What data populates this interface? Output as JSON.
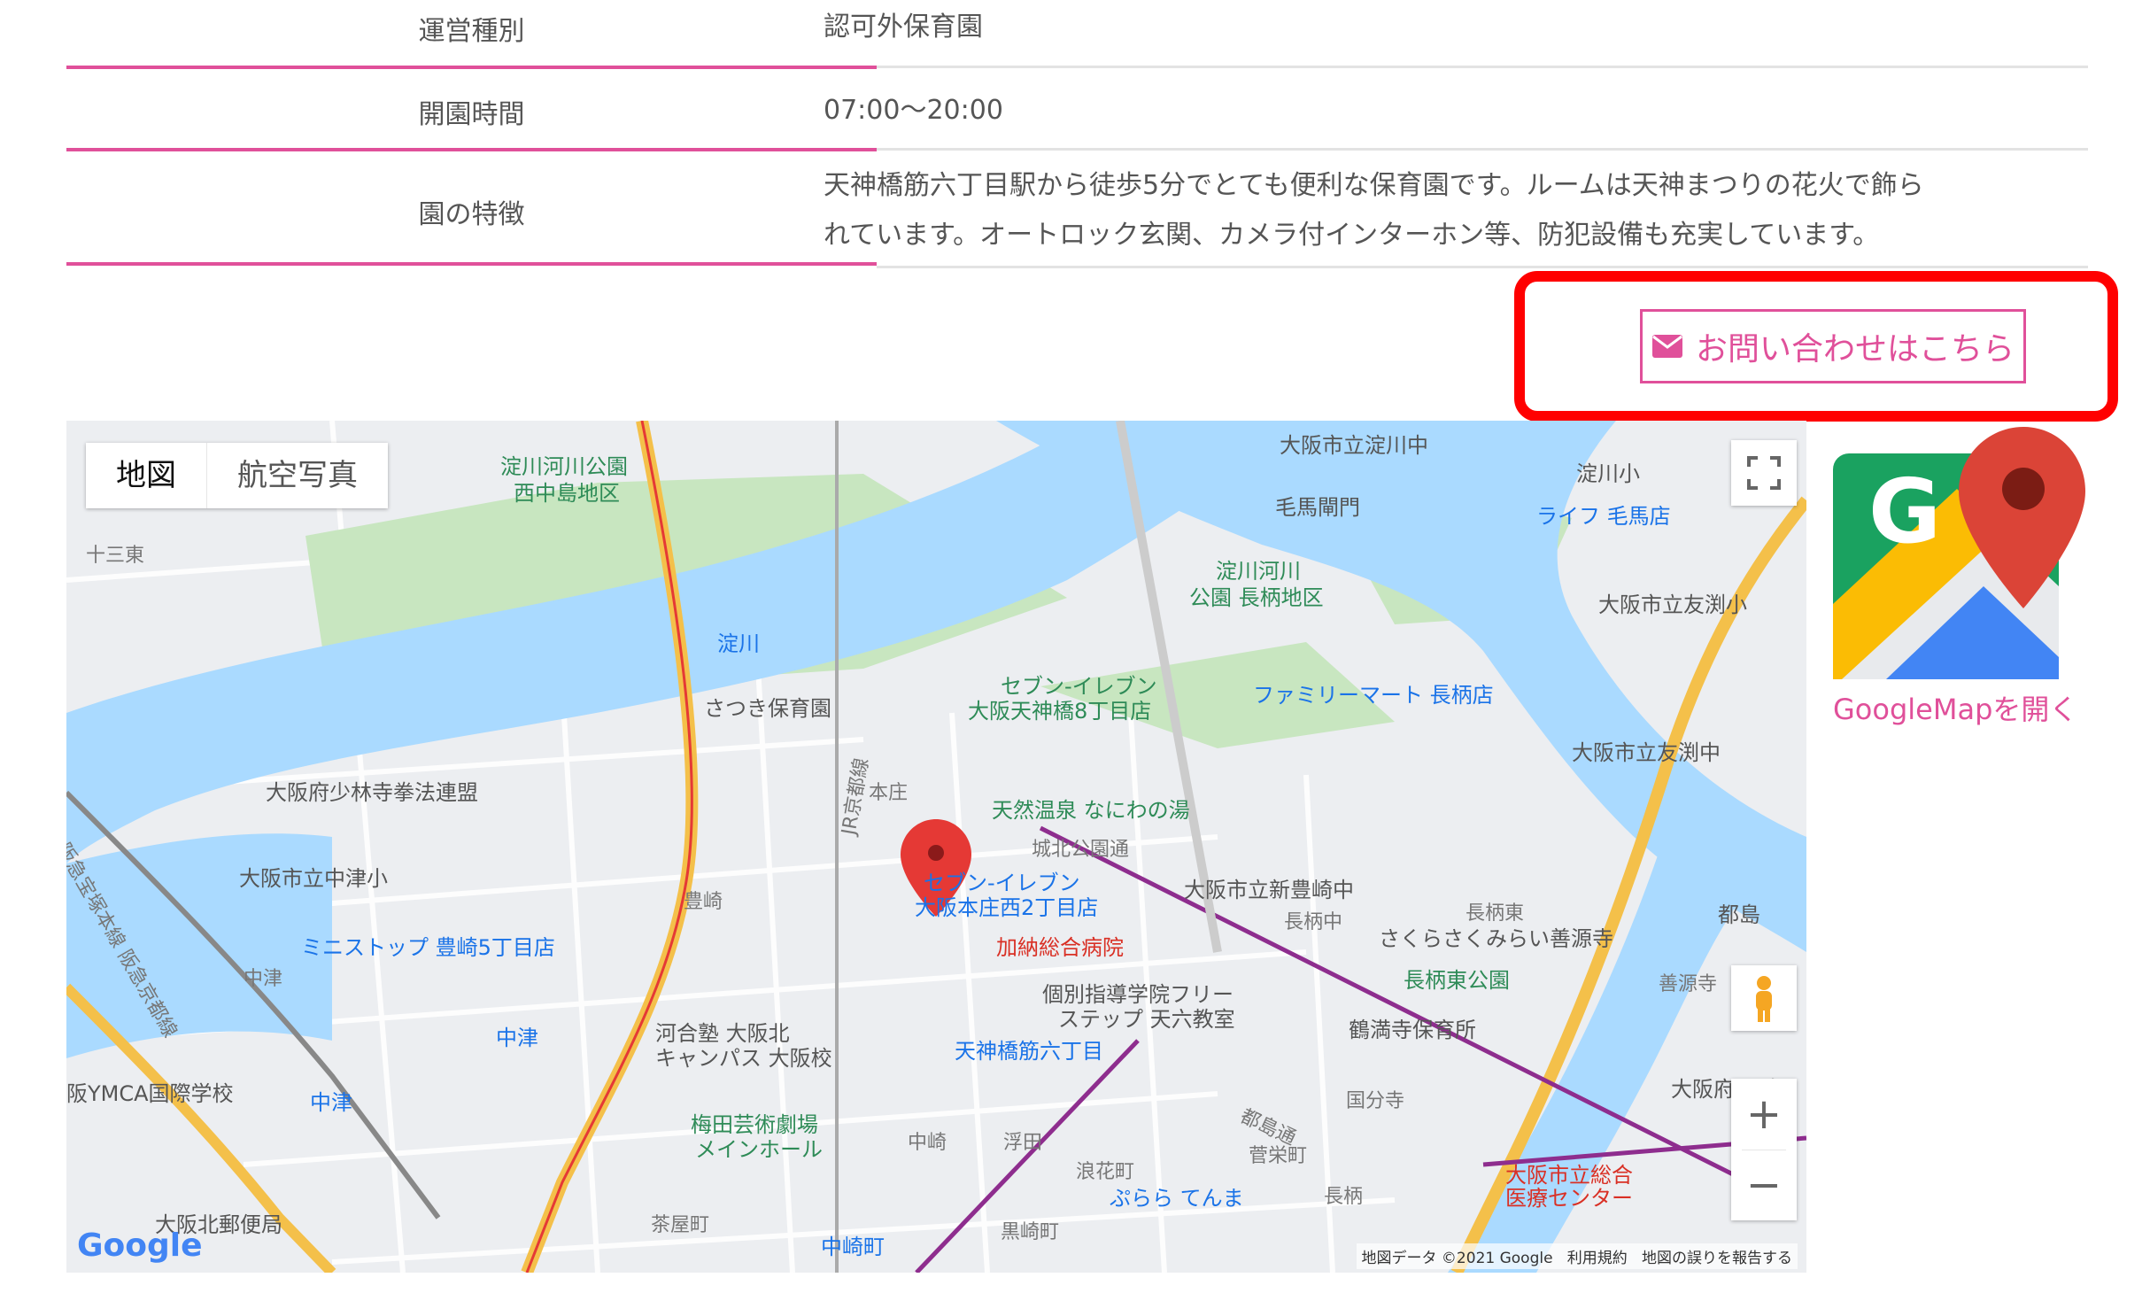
{
  "info_table": [
    {
      "label": "運営種別",
      "value": "認可外保育園"
    },
    {
      "label": "開園時間",
      "value": "07:00〜20:00"
    },
    {
      "label": "園の特徴",
      "value_lines": [
        "天神橋筋六丁目駅から徒歩5分でとても便利な保育園です。ルームは天神まつりの花火で飾ら",
        "れています。オートロック玄関、カメラ付インターホン等、防犯設備も充実しています。"
      ]
    }
  ],
  "contact_button": {
    "label": "お問い合わせはこちら",
    "icon": "envelope-icon"
  },
  "map": {
    "type_tabs": [
      "地図",
      "航空写真"
    ],
    "zoom_in": "+",
    "zoom_out": "−",
    "logo": "Google",
    "attribution": "地図データ ©2021 Google",
    "terms": "利用規約",
    "report": "地図の誤りを報告する",
    "places": {
      "p1": "淀川河川公園",
      "p1b": "西中島地区",
      "p2": "大阪市立淀川中",
      "p3": "淀川小",
      "p4": "毛馬閘門",
      "p5": "ライフ 毛馬店",
      "p6": "十三東",
      "p7": "淀川",
      "p8": "淀川河川",
      "p8b": "公園 長柄地区",
      "p9": "大阪市立友渕小",
      "p10": "さつき保育園",
      "p11": "セブン-イレブン",
      "p11b": "大阪天神橋8丁目店",
      "p12": "ファミリーマート 長柄店",
      "p13": "大阪市立友渕中",
      "p14": "大阪府少林寺拳法連盟",
      "p15": "本庄",
      "p16": "天然温泉 なにわの湯",
      "p17": "城北公園通",
      "p18": "大阪市立中津小",
      "p19": "セブン-イレブン",
      "p19b": "大阪本庄西2丁目店",
      "p20": "大阪市立新豊崎中",
      "p21": "豊崎",
      "p22": "長柄東",
      "p23": "長柄中",
      "p24": "都島",
      "p25": "ミニストップ 豊崎5丁目店",
      "p26": "加納総合病院",
      "p27": "さくらさくみらい善源寺",
      "p28": "中津",
      "p29": "個別指導学院フリー",
      "p29b": "ステップ 天六教室",
      "p30": "長柄東公園",
      "p31": "善源寺",
      "p32": "中津",
      "p33": "河合塾 大阪北",
      "p33b": "キャンパス 大阪校",
      "p34": "鶴満寺保育所",
      "p35": "天神橋筋六丁目",
      "p36": "阪YMCA国際学校",
      "p37": "中津",
      "p38": "梅田芸術劇場",
      "p38b": "メインホール",
      "p39": "国分寺",
      "p40": "大阪府 都島",
      "p41": "中崎",
      "p42": "浮田",
      "p43": "浪花町",
      "p44": "菅栄町",
      "p45": "大阪市立総合",
      "p45b": "医療センター",
      "p46": "大阪北郵便局",
      "p47": "茶屋町",
      "p48": "ぷらら てんま",
      "p49": "黒崎町",
      "p50": "中崎町",
      "p51": "長柄",
      "p52": "阪急宝塚本線 阪急京都線",
      "p53": "JR京都線",
      "p54": "都島通",
      "p55": "毛馬店",
      "p56": "毛"
    }
  },
  "google_map_link": {
    "label": "GoogleMapを開く",
    "icon": "google-maps-icon"
  },
  "colors": {
    "accent": "#e0509a",
    "highlight": "#ff0000",
    "water": "#aadaff",
    "park": "#c5e8c5"
  }
}
